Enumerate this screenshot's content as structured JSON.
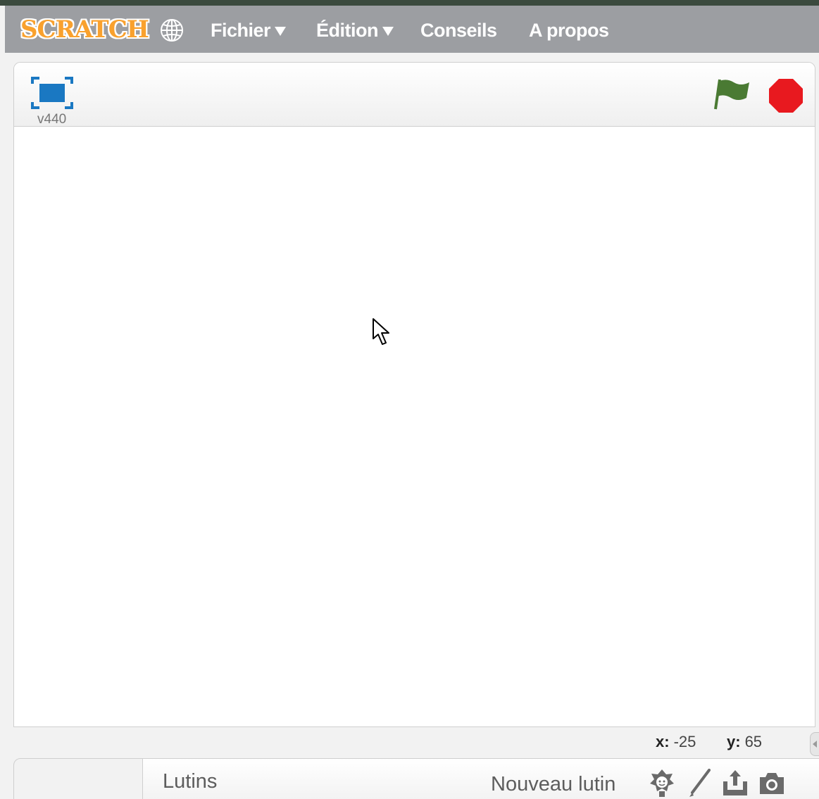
{
  "app": {
    "logo_text": "SCRATCH",
    "brand_color": "#f9a12e",
    "menubar_color": "#9c9ea2"
  },
  "menu": {
    "language_icon": "globe-icon",
    "file_label": "Fichier",
    "edit_label": "Édition",
    "tips_label": "Conseils",
    "about_label": "A propos"
  },
  "stage": {
    "version_label": "v440",
    "fullscreen_icon": "fullscreen-icon",
    "green_flag_icon": "green-flag-icon",
    "stop_icon": "stop-icon",
    "flag_color": "#4a7a33",
    "stop_color": "#e8191f"
  },
  "mouse": {
    "x_label": "x:",
    "x_value": "-25",
    "y_label": "y:",
    "y_value": "65"
  },
  "sprites": {
    "title": "Lutins",
    "new_sprite_label": "Nouveau lutin",
    "tools": [
      "sprite-library-icon",
      "paint-brush-icon",
      "upload-icon",
      "camera-icon"
    ]
  }
}
